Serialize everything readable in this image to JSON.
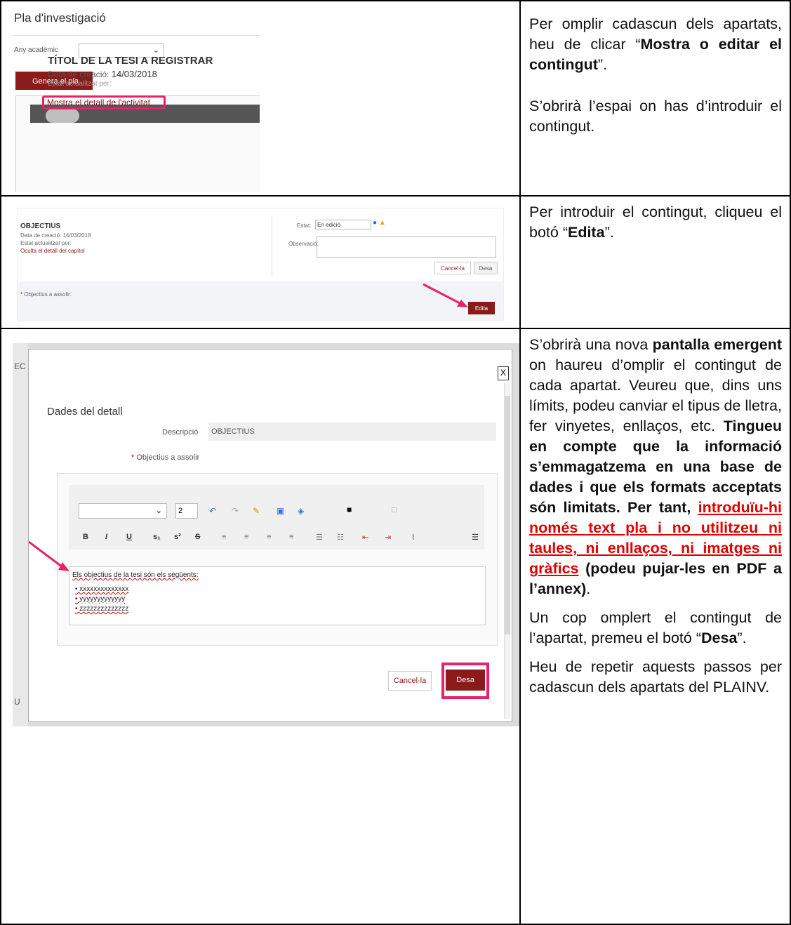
{
  "section1": {
    "screenshot": {
      "title": "Pla d'investigació",
      "any_label": "Any acadèmic",
      "generate_button": "Genera el pla",
      "thesis_title": "TÍTOL DE LA TESI A REGISTRAR",
      "date_label": "Data de creació:",
      "date_value": "14/03/2018",
      "state_label": "Estat actualitzat per:",
      "detail_link": "Mostra el detall de l'activitat"
    },
    "instruction_p1_pre": "Per omplir cadascun dels apartats, heu de clicar “",
    "instruction_p1_bold": "Mostra o editar el contingut",
    "instruction_p1_post": "”.",
    "instruction_p2": "S’obrirà l’espai on has d’introduir el contingut."
  },
  "section2": {
    "screenshot": {
      "heading": "OBJECTIUS",
      "date_line": "Data de creació: 14/03/2018",
      "state_line": "Estat actualitzat per:",
      "hide_link": "Oculta el detall del capítol",
      "estat_label": "Estat:",
      "estat_value": "En edició",
      "obs_label": "Observació:",
      "cancel_button": "Cancel·la",
      "save_button": "Desa",
      "field_label": "Objectius a assolir:",
      "edit_button": "Edita"
    },
    "instruction_pre": "Per introduir el contingut, cliqueu el botó “",
    "instruction_bold": "Edita",
    "instruction_post": "”."
  },
  "section3": {
    "screenshot": {
      "modal_title": "Dades del detall",
      "desc_label": "Descripció",
      "desc_value": "OBJECTIUS",
      "obj_label": "Objectius a assolir",
      "font_size": "2",
      "text_line1": "Els objectius de la tesi són els següents:",
      "text_line2": "• xxxxxxxxxxxxxx",
      "text_line3": "• yyyyyyyyyyyyy",
      "text_line4": "• zzzzzzzzzzzzzz",
      "cancel_button": "Cancel·la",
      "save_button": "Desa",
      "close_glyph": "X",
      "side_top": "EC",
      "side_bottom": "U"
    },
    "p1_a": "S’obrirà una nova ",
    "p1_b": "pantalla emergent",
    "p1_c": " on haureu d’omplir el contingut de cada apartat. Veureu que, dins uns límits, podeu canviar el tipus de lletra, fer vinyetes, enllaços, etc. ",
    "p1_d": "Tingueu en compte que la informació s’emmagatzema en una base de dades i que els formats acceptats són limitats. Per tant, ",
    "p1_e": "introduïu-hi només text pla i no utilitzeu ni taules, ni enllaços, ni imatges ni gràfics",
    "p1_f": " (podeu pujar-les en PDF a l’annex)",
    "p1_g": ".",
    "p2_a": "Un cop omplert el contingut de l’apartat, premeu el botó “",
    "p2_b": "Desa",
    "p2_c": "”.",
    "p3": "Heu de repetir aquests passos per cadascun dels apartats del PLAINV."
  },
  "colors": {
    "brand": "#8b1a1a",
    "highlight": "#e8216b",
    "warning_text": "#e00000"
  }
}
